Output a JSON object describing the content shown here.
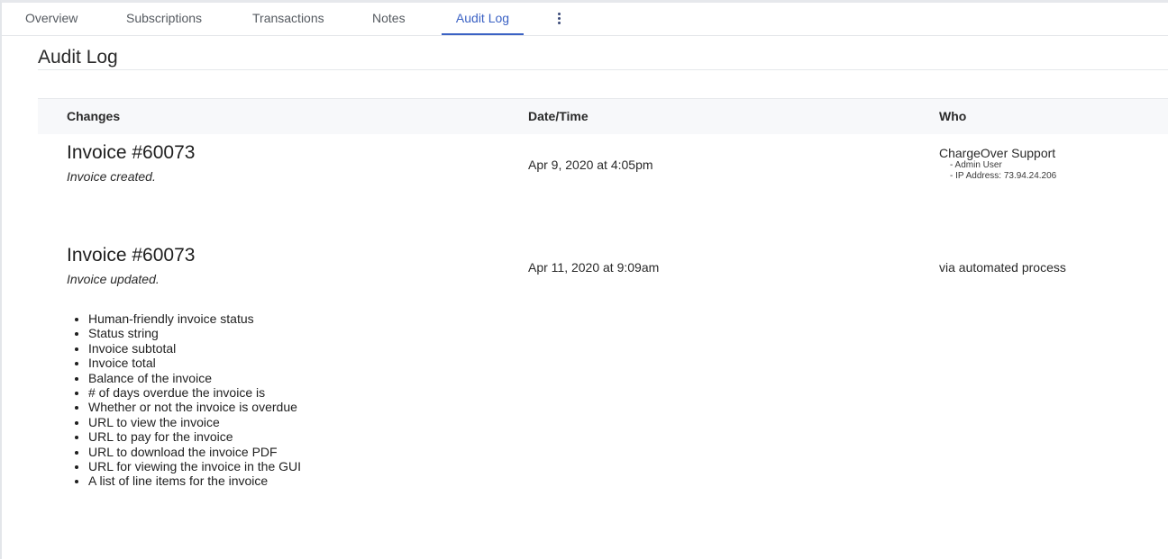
{
  "tabs": [
    {
      "label": "Overview"
    },
    {
      "label": "Subscriptions"
    },
    {
      "label": "Transactions"
    },
    {
      "label": "Notes"
    },
    {
      "label": "Audit Log",
      "active": true
    }
  ],
  "page": {
    "title": "Audit Log"
  },
  "table": {
    "columns": [
      "Changes",
      "Date/Time",
      "Who"
    ],
    "entries": [
      {
        "title": "Invoice #60073",
        "description": "Invoice created.",
        "datetime": "Apr 9, 2020 at 4:05pm",
        "who": "ChargeOver Support",
        "who_details": [
          "- Admin User",
          "- IP Address: 73.94.24.206"
        ]
      },
      {
        "title": "Invoice #60073",
        "description": "Invoice updated.",
        "datetime": "Apr 11, 2020 at 9:09am",
        "who": "via automated process",
        "changes": [
          "Human-friendly invoice status",
          "Status string",
          "Invoice subtotal",
          "Invoice total",
          "Balance of the invoice",
          "# of days overdue the invoice is",
          "Whether or not the invoice is overdue",
          "URL to view the invoice",
          "URL to pay for the invoice",
          "URL to download the invoice PDF",
          "URL for viewing the invoice in the GUI",
          "A list of line items for the invoice"
        ]
      }
    ]
  },
  "colors": {
    "accent": "#3b62c4",
    "header_bg": "#f7f8fa",
    "divider": "#e6e8eb"
  },
  "icons": {
    "more": "vertical-ellipsis-icon"
  }
}
